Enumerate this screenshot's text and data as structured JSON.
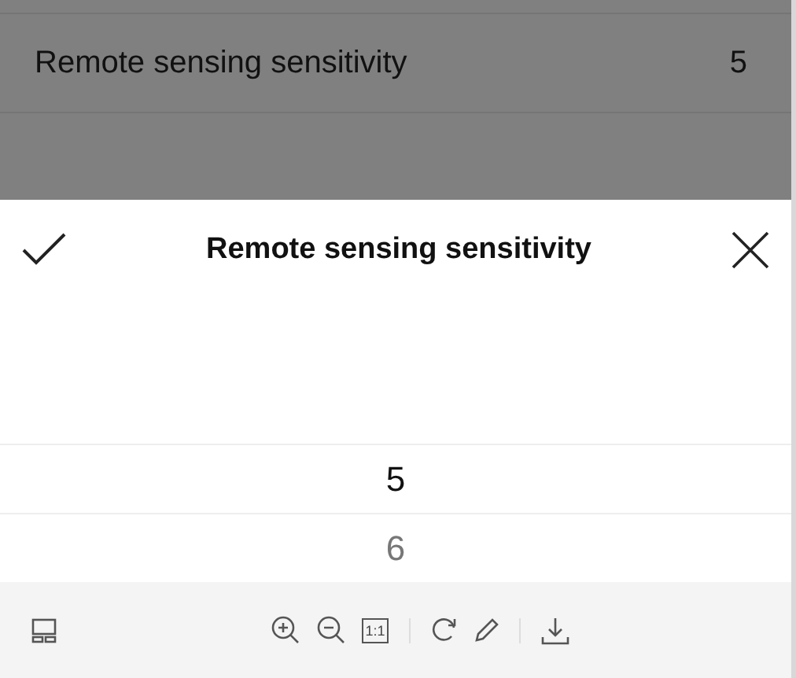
{
  "background_list": {
    "rows": [
      {
        "label": "Remote sensing sensitivity",
        "value": "5"
      }
    ]
  },
  "sheet": {
    "title": "Remote sensing sensitivity",
    "options": [
      {
        "label": "5",
        "selected": true
      },
      {
        "label": "6",
        "selected": false
      }
    ]
  },
  "toolbar": {
    "tools": [
      {
        "kind": "layout"
      },
      {
        "kind": "gap"
      },
      {
        "kind": "zoom-in"
      },
      {
        "kind": "zoom-out"
      },
      {
        "kind": "actual-size",
        "label": "1:1"
      },
      {
        "kind": "divider"
      },
      {
        "kind": "rotate"
      },
      {
        "kind": "edit"
      },
      {
        "kind": "divider"
      },
      {
        "kind": "download"
      }
    ]
  }
}
